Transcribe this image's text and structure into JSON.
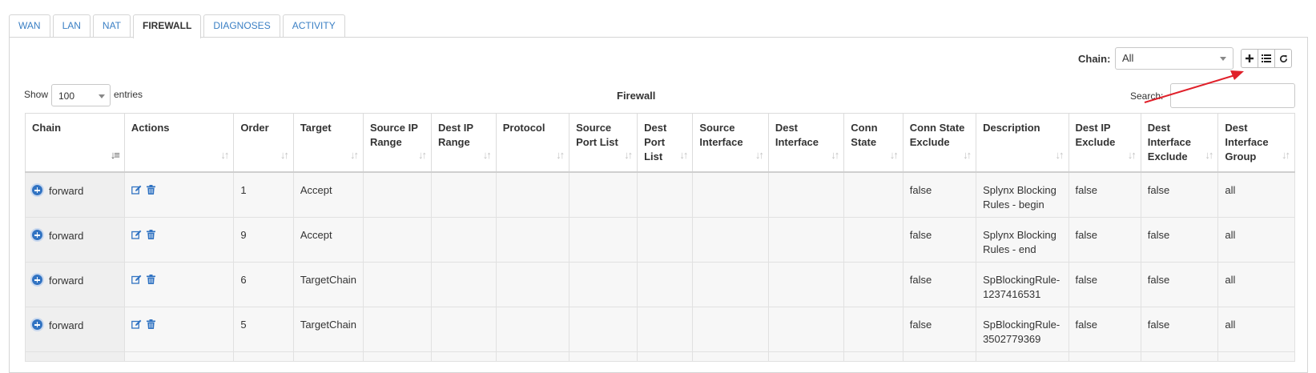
{
  "tabs": [
    {
      "label": "WAN",
      "active": false
    },
    {
      "label": "LAN",
      "active": false
    },
    {
      "label": "NAT",
      "active": false
    },
    {
      "label": "FIREWALL",
      "active": true
    },
    {
      "label": "DIAGNOSES",
      "active": false
    },
    {
      "label": "ACTIVITY",
      "active": false
    }
  ],
  "toolbar": {
    "chain_label": "Chain:",
    "chain_value": "All",
    "buttons": [
      "plus-icon",
      "list-icon",
      "refresh-icon"
    ]
  },
  "table_controls": {
    "show_label": "Show",
    "page_size": "100",
    "entries_label": "entries",
    "title": "Firewall",
    "search_label": "Search:",
    "search_value": ""
  },
  "columns": [
    "Chain",
    "Actions",
    "Order",
    "Target",
    "Source IP Range",
    "Dest IP Range",
    "Protocol",
    "Source Port List",
    "Dest Port List",
    "Source Interface",
    "Dest Interface",
    "Conn State",
    "Conn State Exclude",
    "Description",
    "Dest IP Exclude",
    "Dest Interface Exclude",
    "Dest Interface Group"
  ],
  "rows": [
    {
      "chain": "forward",
      "order": "1",
      "target": "Accept",
      "source_ip_range": "",
      "dest_ip_range": "",
      "protocol": "",
      "source_port_list": "",
      "dest_port_list": "",
      "source_interface": "",
      "dest_interface": "",
      "conn_state": "",
      "conn_state_exclude": "false",
      "description": "Splynx Blocking Rules - begin",
      "dest_ip_exclude": "false",
      "dest_interface_exclude": "false",
      "dest_interface_group": "all"
    },
    {
      "chain": "forward",
      "order": "9",
      "target": "Accept",
      "source_ip_range": "",
      "dest_ip_range": "",
      "protocol": "",
      "source_port_list": "",
      "dest_port_list": "",
      "source_interface": "",
      "dest_interface": "",
      "conn_state": "",
      "conn_state_exclude": "false",
      "description": "Splynx Blocking Rules - end",
      "dest_ip_exclude": "false",
      "dest_interface_exclude": "false",
      "dest_interface_group": "all"
    },
    {
      "chain": "forward",
      "order": "6",
      "target": "TargetChain",
      "source_ip_range": "",
      "dest_ip_range": "",
      "protocol": "",
      "source_port_list": "",
      "dest_port_list": "",
      "source_interface": "",
      "dest_interface": "",
      "conn_state": "",
      "conn_state_exclude": "false",
      "description": "SpBlockingRule-1237416531",
      "dest_ip_exclude": "false",
      "dest_interface_exclude": "false",
      "dest_interface_group": "all"
    },
    {
      "chain": "forward",
      "order": "5",
      "target": "TargetChain",
      "source_ip_range": "",
      "dest_ip_range": "",
      "protocol": "",
      "source_port_list": "",
      "dest_port_list": "",
      "source_interface": "",
      "dest_interface": "",
      "conn_state": "",
      "conn_state_exclude": "false",
      "description": "SpBlockingRule-3502779369",
      "dest_ip_exclude": "false",
      "dest_interface_exclude": "false",
      "dest_interface_group": "all"
    }
  ],
  "row_action_icons": [
    "edit-icon",
    "delete-icon"
  ],
  "colors": {
    "link": "#3a7fc4",
    "expand_button": "#3173c2",
    "annotation_arrow": "#e0202a"
  }
}
